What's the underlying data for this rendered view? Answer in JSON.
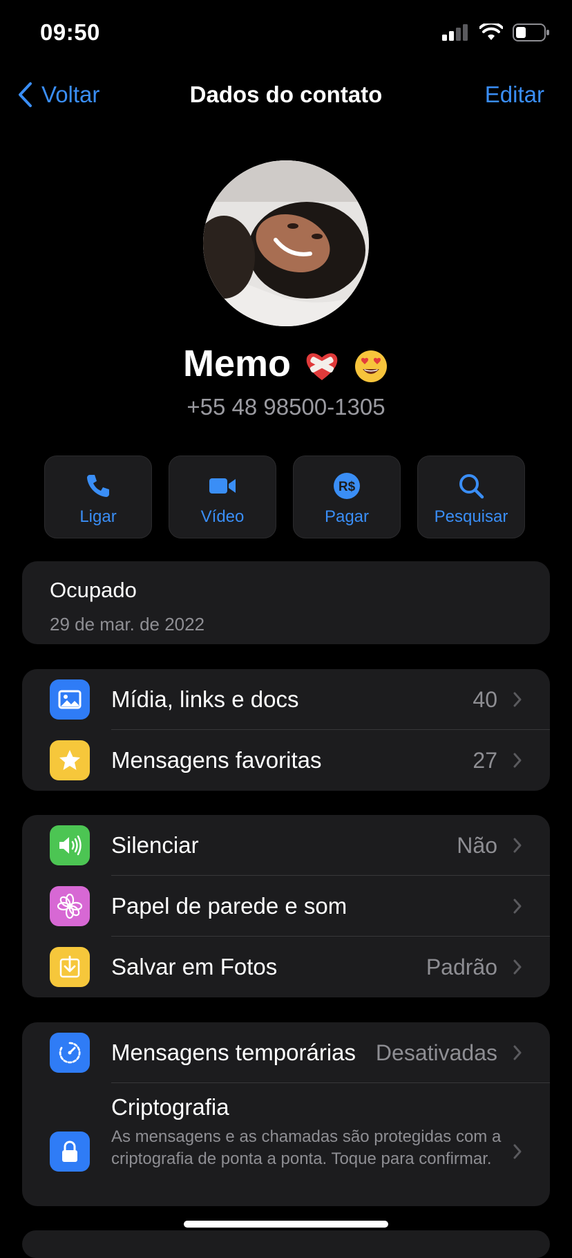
{
  "status_bar": {
    "time": "09:50"
  },
  "nav": {
    "back_label": "Voltar",
    "title": "Dados do contato",
    "edit_label": "Editar"
  },
  "profile": {
    "name": "Memo",
    "phone": "+55 48 98500-1305"
  },
  "actions": [
    {
      "label": "Ligar",
      "icon": "phone-icon"
    },
    {
      "label": "Vídeo",
      "icon": "video-icon"
    },
    {
      "label": "Pagar",
      "icon": "pay-icon"
    },
    {
      "label": "Pesquisar",
      "icon": "search-icon"
    }
  ],
  "pay_icon_text": "R$",
  "about": {
    "status": "Ocupado",
    "date": "29 de mar. de 2022"
  },
  "media_section": {
    "items": [
      {
        "label": "Mídia, links e docs",
        "value": "40",
        "icon": "image-icon",
        "color": "#2f7cf6"
      },
      {
        "label": "Mensagens favoritas",
        "value": "27",
        "icon": "star-icon",
        "color": "#f6c73b"
      }
    ]
  },
  "settings_section": {
    "items": [
      {
        "label": "Silenciar",
        "value": "Não",
        "icon": "speaker-icon",
        "color": "#4cc553"
      },
      {
        "label": "Papel de parede e som",
        "value": "",
        "icon": "flower-icon",
        "color": "#d768d4"
      },
      {
        "label": "Salvar em Fotos",
        "value": "Padrão",
        "icon": "download-icon",
        "color": "#f6c73b"
      }
    ]
  },
  "privacy_section": {
    "disappearing": {
      "label": "Mensagens temporárias",
      "value": "Desativadas",
      "icon": "timer-icon",
      "color": "#2f7cf6"
    },
    "encryption": {
      "title": "Criptografia",
      "description": "As mensagens e as chamadas são protegidas com a criptografia de ponta a ponta. Toque para confirmar.",
      "icon": "lock-icon",
      "color": "#2f7cf6"
    }
  },
  "accent_color": "#3a8ef6"
}
